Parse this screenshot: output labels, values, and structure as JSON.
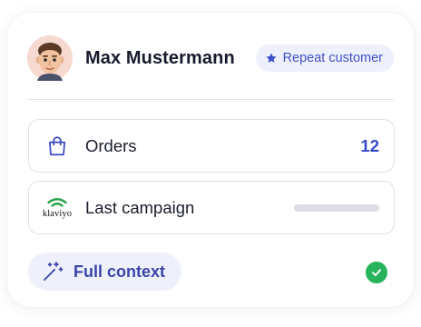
{
  "customer": {
    "name": "Max Mustermann",
    "badge_label": "Repeat customer"
  },
  "rows": [
    {
      "label": "Orders",
      "value": "12",
      "icon": "shopping-bag-icon"
    },
    {
      "label": "Last campaign",
      "value": null,
      "icon": "klaviyo-logo",
      "logo_text": "klaviyo"
    }
  ],
  "action": {
    "label": "Full context",
    "icon": "magic-wand-icon",
    "status_icon": "check-circle-icon"
  },
  "colors": {
    "accent": "#3849c7",
    "badge_bg": "#eef1fb",
    "pill_bg": "#eef0fb",
    "success": "#26b35a",
    "klaviyo_green": "#27a34a"
  }
}
